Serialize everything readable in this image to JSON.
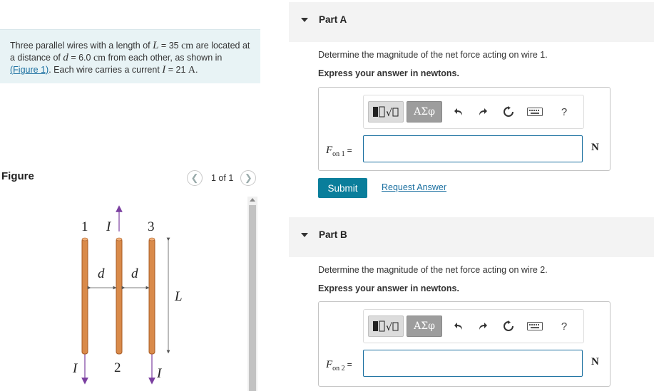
{
  "problem": {
    "t1": "Three parallel wires with a length of ",
    "L_var": "L",
    "t2": " = 35 ",
    "L_unit": "cm",
    "t3": " are located at a distance of ",
    "d_var": "d",
    "t4": " = 6.0 ",
    "d_unit": "cm",
    "t5": " from each other, as shown in ",
    "fig_link": "(Figure 1)",
    "t6": ". Each wire carries a current ",
    "I_var": "I",
    "t7": " = 21 ",
    "I_unit": "A",
    "t8": "."
  },
  "figure": {
    "label": "Figure",
    "count": "1 of 1",
    "prev_icon": "chevron-left-icon",
    "next_icon": "chevron-right-icon",
    "labels": {
      "w1": "1",
      "w2": "2",
      "w3": "3",
      "I_top": "I",
      "I_left": "I",
      "I_right": "I",
      "d1": "d",
      "d2": "d",
      "L": "L"
    },
    "colors": {
      "wire": "#d98a4a",
      "wire_edge": "#a85c26",
      "arrow": "#7a3fa0"
    }
  },
  "partA": {
    "title": "Part A",
    "prompt": "Determine the magnitude of the net force acting on wire 1.",
    "instruction": "Express your answer in newtons.",
    "var": "F",
    "sub": "on 1",
    "eq": "=",
    "unit": "N",
    "value": ""
  },
  "partB": {
    "title": "Part B",
    "prompt": "Determine the magnitude of the net force acting on wire 2.",
    "instruction": "Express your answer in newtons.",
    "var": "F",
    "sub": "on 2",
    "eq": "=",
    "unit": "N",
    "value": ""
  },
  "toolbar": {
    "greek": "ΑΣφ",
    "help": "?",
    "icons": [
      "templates-icon",
      "greek-letters-icon",
      "undo-icon",
      "redo-icon",
      "reset-icon",
      "keyboard-icon",
      "help-icon"
    ]
  },
  "actions": {
    "submit": "Submit",
    "request": "Request Answer"
  }
}
